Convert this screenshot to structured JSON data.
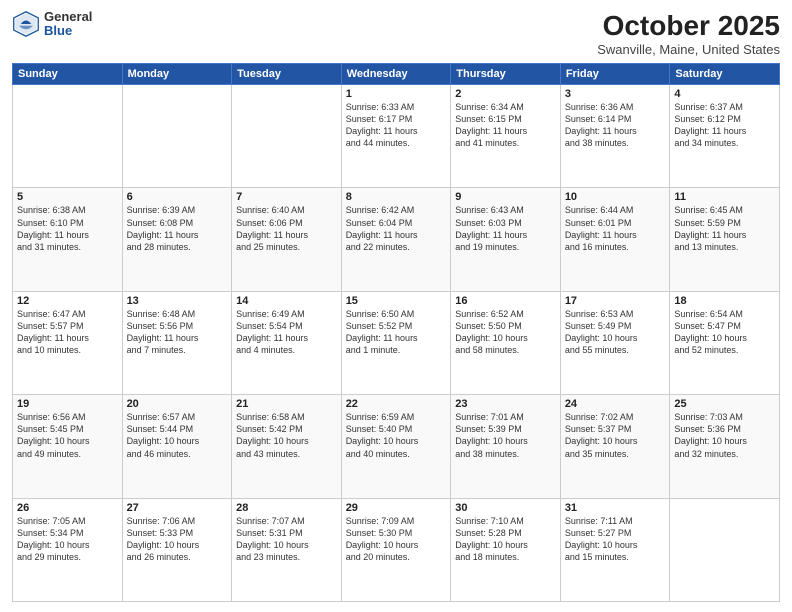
{
  "logo": {
    "general": "General",
    "blue": "Blue"
  },
  "title": {
    "month": "October 2025",
    "location": "Swanville, Maine, United States"
  },
  "days_header": [
    "Sunday",
    "Monday",
    "Tuesday",
    "Wednesday",
    "Thursday",
    "Friday",
    "Saturday"
  ],
  "weeks": [
    [
      {
        "day": "",
        "info": ""
      },
      {
        "day": "",
        "info": ""
      },
      {
        "day": "",
        "info": ""
      },
      {
        "day": "1",
        "info": "Sunrise: 6:33 AM\nSunset: 6:17 PM\nDaylight: 11 hours\nand 44 minutes."
      },
      {
        "day": "2",
        "info": "Sunrise: 6:34 AM\nSunset: 6:15 PM\nDaylight: 11 hours\nand 41 minutes."
      },
      {
        "day": "3",
        "info": "Sunrise: 6:36 AM\nSunset: 6:14 PM\nDaylight: 11 hours\nand 38 minutes."
      },
      {
        "day": "4",
        "info": "Sunrise: 6:37 AM\nSunset: 6:12 PM\nDaylight: 11 hours\nand 34 minutes."
      }
    ],
    [
      {
        "day": "5",
        "info": "Sunrise: 6:38 AM\nSunset: 6:10 PM\nDaylight: 11 hours\nand 31 minutes."
      },
      {
        "day": "6",
        "info": "Sunrise: 6:39 AM\nSunset: 6:08 PM\nDaylight: 11 hours\nand 28 minutes."
      },
      {
        "day": "7",
        "info": "Sunrise: 6:40 AM\nSunset: 6:06 PM\nDaylight: 11 hours\nand 25 minutes."
      },
      {
        "day": "8",
        "info": "Sunrise: 6:42 AM\nSunset: 6:04 PM\nDaylight: 11 hours\nand 22 minutes."
      },
      {
        "day": "9",
        "info": "Sunrise: 6:43 AM\nSunset: 6:03 PM\nDaylight: 11 hours\nand 19 minutes."
      },
      {
        "day": "10",
        "info": "Sunrise: 6:44 AM\nSunset: 6:01 PM\nDaylight: 11 hours\nand 16 minutes."
      },
      {
        "day": "11",
        "info": "Sunrise: 6:45 AM\nSunset: 5:59 PM\nDaylight: 11 hours\nand 13 minutes."
      }
    ],
    [
      {
        "day": "12",
        "info": "Sunrise: 6:47 AM\nSunset: 5:57 PM\nDaylight: 11 hours\nand 10 minutes."
      },
      {
        "day": "13",
        "info": "Sunrise: 6:48 AM\nSunset: 5:56 PM\nDaylight: 11 hours\nand 7 minutes."
      },
      {
        "day": "14",
        "info": "Sunrise: 6:49 AM\nSunset: 5:54 PM\nDaylight: 11 hours\nand 4 minutes."
      },
      {
        "day": "15",
        "info": "Sunrise: 6:50 AM\nSunset: 5:52 PM\nDaylight: 11 hours\nand 1 minute."
      },
      {
        "day": "16",
        "info": "Sunrise: 6:52 AM\nSunset: 5:50 PM\nDaylight: 10 hours\nand 58 minutes."
      },
      {
        "day": "17",
        "info": "Sunrise: 6:53 AM\nSunset: 5:49 PM\nDaylight: 10 hours\nand 55 minutes."
      },
      {
        "day": "18",
        "info": "Sunrise: 6:54 AM\nSunset: 5:47 PM\nDaylight: 10 hours\nand 52 minutes."
      }
    ],
    [
      {
        "day": "19",
        "info": "Sunrise: 6:56 AM\nSunset: 5:45 PM\nDaylight: 10 hours\nand 49 minutes."
      },
      {
        "day": "20",
        "info": "Sunrise: 6:57 AM\nSunset: 5:44 PM\nDaylight: 10 hours\nand 46 minutes."
      },
      {
        "day": "21",
        "info": "Sunrise: 6:58 AM\nSunset: 5:42 PM\nDaylight: 10 hours\nand 43 minutes."
      },
      {
        "day": "22",
        "info": "Sunrise: 6:59 AM\nSunset: 5:40 PM\nDaylight: 10 hours\nand 40 minutes."
      },
      {
        "day": "23",
        "info": "Sunrise: 7:01 AM\nSunset: 5:39 PM\nDaylight: 10 hours\nand 38 minutes."
      },
      {
        "day": "24",
        "info": "Sunrise: 7:02 AM\nSunset: 5:37 PM\nDaylight: 10 hours\nand 35 minutes."
      },
      {
        "day": "25",
        "info": "Sunrise: 7:03 AM\nSunset: 5:36 PM\nDaylight: 10 hours\nand 32 minutes."
      }
    ],
    [
      {
        "day": "26",
        "info": "Sunrise: 7:05 AM\nSunset: 5:34 PM\nDaylight: 10 hours\nand 29 minutes."
      },
      {
        "day": "27",
        "info": "Sunrise: 7:06 AM\nSunset: 5:33 PM\nDaylight: 10 hours\nand 26 minutes."
      },
      {
        "day": "28",
        "info": "Sunrise: 7:07 AM\nSunset: 5:31 PM\nDaylight: 10 hours\nand 23 minutes."
      },
      {
        "day": "29",
        "info": "Sunrise: 7:09 AM\nSunset: 5:30 PM\nDaylight: 10 hours\nand 20 minutes."
      },
      {
        "day": "30",
        "info": "Sunrise: 7:10 AM\nSunset: 5:28 PM\nDaylight: 10 hours\nand 18 minutes."
      },
      {
        "day": "31",
        "info": "Sunrise: 7:11 AM\nSunset: 5:27 PM\nDaylight: 10 hours\nand 15 minutes."
      },
      {
        "day": "",
        "info": ""
      }
    ]
  ]
}
